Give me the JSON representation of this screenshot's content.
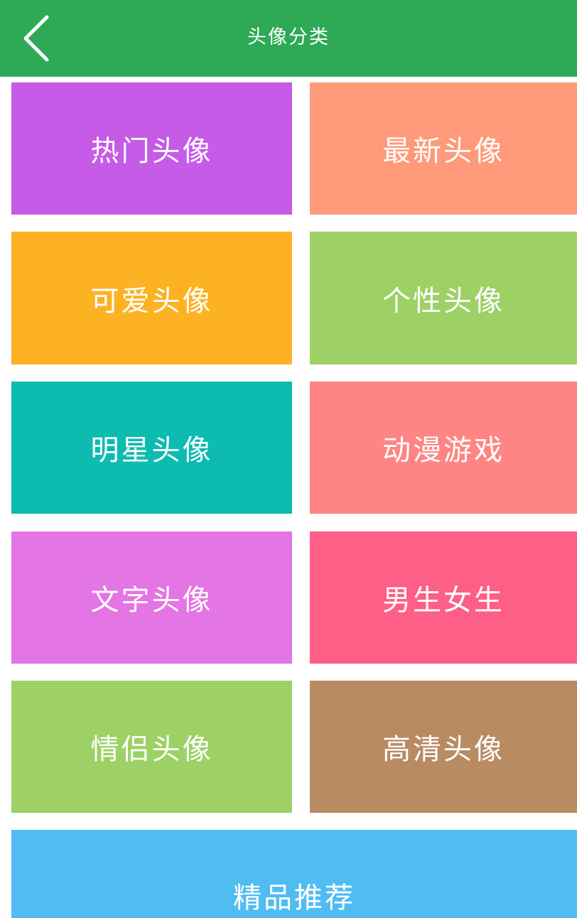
{
  "header": {
    "back_icon": "chevron-left-icon",
    "title": "头像分类",
    "background": "#2ea955"
  },
  "categories": [
    {
      "label": "热门头像",
      "color": "#c65be8"
    },
    {
      "label": "最新头像",
      "color": "#fe9a7a"
    },
    {
      "label": "可爱头像",
      "color": "#fdb223"
    },
    {
      "label": "个性头像",
      "color": "#9dd166"
    },
    {
      "label": "明星头像",
      "color": "#0dbbb1"
    },
    {
      "label": "动漫游戏",
      "color": "#fe8583"
    },
    {
      "label": "文字头像",
      "color": "#e475e4"
    },
    {
      "label": "男生女生",
      "color": "#fe5f86"
    },
    {
      "label": "情侣头像",
      "color": "#9dd166"
    },
    {
      "label": "高清头像",
      "color": "#b98b62"
    }
  ],
  "featured": {
    "label": "精品推荐",
    "color": "#50bcf2"
  }
}
